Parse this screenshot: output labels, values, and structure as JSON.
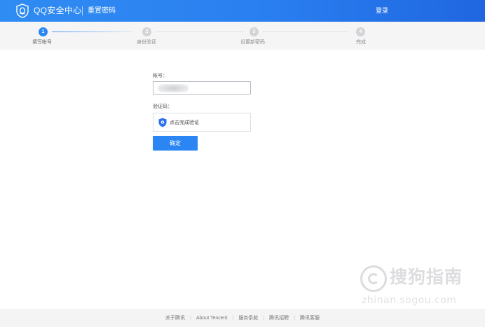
{
  "header": {
    "brand": "QQ安全中心",
    "title": "重置密码",
    "login_label": "登录"
  },
  "steps": [
    {
      "number": "1",
      "label": "填写帐号",
      "active": true
    },
    {
      "number": "2",
      "label": "身份验证",
      "active": false
    },
    {
      "number": "3",
      "label": "设置新密码",
      "active": false
    },
    {
      "number": "4",
      "label": "完成",
      "active": false
    }
  ],
  "form": {
    "account_label": "帐号：",
    "account_value": "",
    "captcha_label": "验证码：",
    "captcha_prompt": "点击完成验证",
    "confirm_label": "确定"
  },
  "footer": {
    "links": [
      "关于腾讯",
      "About Tencent",
      "服务条款",
      "腾讯招聘",
      "腾讯客服"
    ]
  },
  "watermark": {
    "text": "搜狗指南",
    "url": "zhinan.sogou.com"
  },
  "colors": {
    "accent": "#2b86f3",
    "header_start": "#2f8cf2",
    "header_end": "#1f66e0"
  },
  "icons": {
    "logo": "qq-shield-logo-icon",
    "captcha": "shield-check-icon"
  }
}
